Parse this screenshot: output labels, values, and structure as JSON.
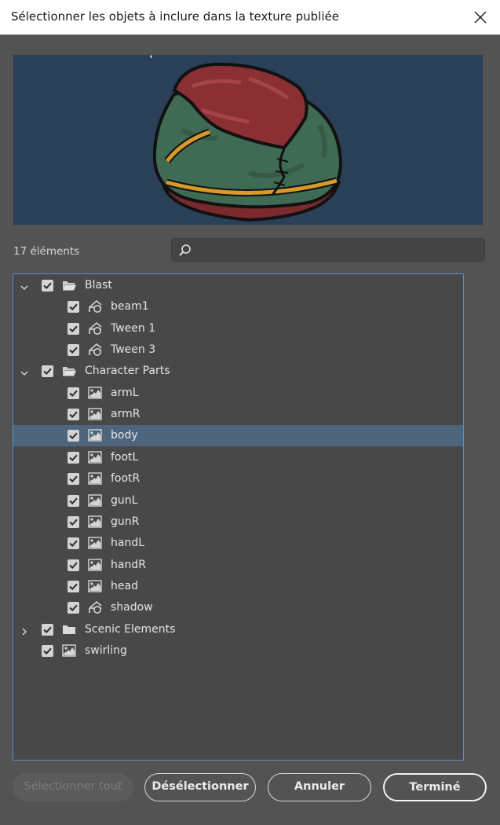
{
  "dialog": {
    "title": "Sélectionner les objets à inclure dans la texture publiée"
  },
  "list": {
    "count_label": "17 éléments",
    "search_placeholder": ""
  },
  "tree": [
    {
      "label": "Blast",
      "depth": 0,
      "kind": "folder-open",
      "expander": "expanded",
      "checked": true,
      "selected": false
    },
    {
      "label": "beam1",
      "depth": 1,
      "kind": "graphic-symbol",
      "checked": true,
      "selected": false
    },
    {
      "label": "Tween 1",
      "depth": 1,
      "kind": "graphic-symbol",
      "checked": true,
      "selected": false
    },
    {
      "label": "Tween 3",
      "depth": 1,
      "kind": "graphic-symbol",
      "checked": true,
      "selected": false
    },
    {
      "label": "Character Parts",
      "depth": 0,
      "kind": "folder-open",
      "expander": "expanded",
      "checked": true,
      "selected": false
    },
    {
      "label": "armL",
      "depth": 1,
      "kind": "bitmap",
      "checked": true,
      "selected": false
    },
    {
      "label": "armR",
      "depth": 1,
      "kind": "bitmap",
      "checked": true,
      "selected": false
    },
    {
      "label": "body",
      "depth": 1,
      "kind": "bitmap",
      "checked": true,
      "selected": true
    },
    {
      "label": "footL",
      "depth": 1,
      "kind": "bitmap",
      "checked": true,
      "selected": false
    },
    {
      "label": "footR",
      "depth": 1,
      "kind": "bitmap",
      "checked": true,
      "selected": false
    },
    {
      "label": "gunL",
      "depth": 1,
      "kind": "bitmap",
      "checked": true,
      "selected": false
    },
    {
      "label": "gunR",
      "depth": 1,
      "kind": "bitmap",
      "checked": true,
      "selected": false
    },
    {
      "label": "handL",
      "depth": 1,
      "kind": "bitmap",
      "checked": true,
      "selected": false
    },
    {
      "label": "handR",
      "depth": 1,
      "kind": "bitmap",
      "checked": true,
      "selected": false
    },
    {
      "label": "head",
      "depth": 1,
      "kind": "bitmap",
      "checked": true,
      "selected": false
    },
    {
      "label": "shadow",
      "depth": 1,
      "kind": "graphic-symbol",
      "checked": true,
      "selected": false
    },
    {
      "label": "Scenic Elements",
      "depth": 0,
      "kind": "folder-closed",
      "expander": "collapsed",
      "checked": true,
      "selected": false
    },
    {
      "label": "swirling",
      "depth": 0,
      "kind": "bitmap",
      "checked": true,
      "selected": false
    }
  ],
  "buttons": {
    "select_all": "Sélectionner tout",
    "deselect": "Désélectionner",
    "cancel": "Annuler",
    "done": "Terminé"
  },
  "colors": {
    "dialog_bg": "#535353",
    "preview_bg": "#2a3f58",
    "selection": "#4d667e",
    "focus_border": "#5b8fc7"
  }
}
